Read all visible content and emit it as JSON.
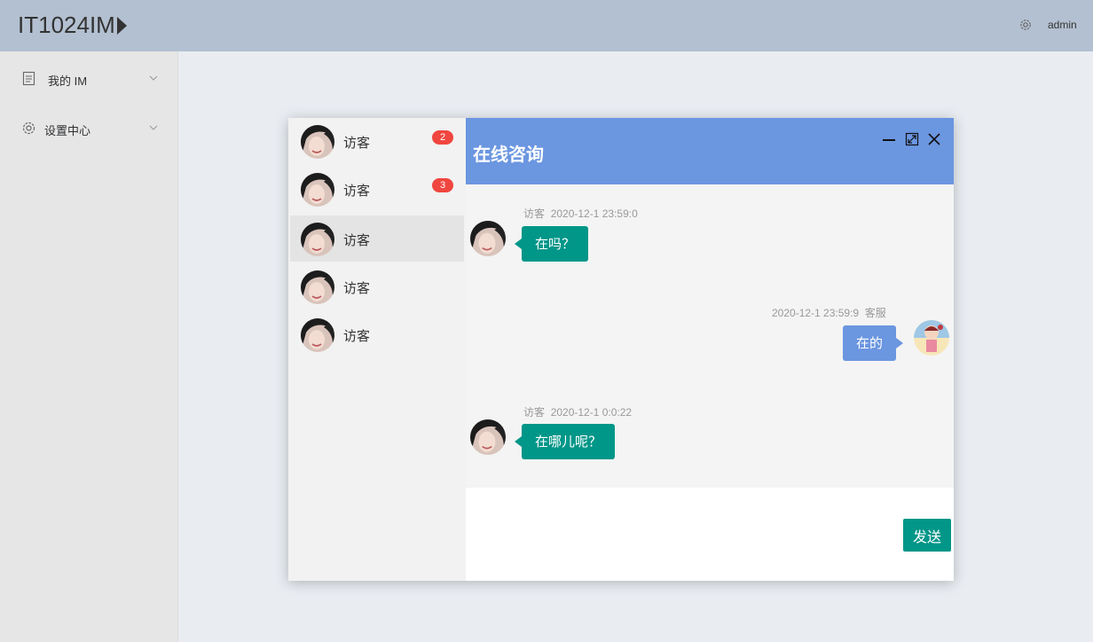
{
  "header": {
    "brand": "IT1024IM",
    "settings_icon": "gear-icon",
    "username": "admin"
  },
  "sidebar": {
    "items": [
      {
        "label": "我的 IM",
        "icon": "document-icon"
      },
      {
        "label": "设置中心",
        "icon": "gear-icon"
      }
    ]
  },
  "contacts": [
    {
      "name": "访客",
      "badge": "2",
      "active": false
    },
    {
      "name": "访客",
      "badge": "3",
      "active": false
    },
    {
      "name": "访客",
      "badge": "",
      "active": true
    },
    {
      "name": "访客",
      "badge": "",
      "active": false
    },
    {
      "name": "访客",
      "badge": "",
      "active": false
    }
  ],
  "chat": {
    "title": "在线咨询",
    "messages": [
      {
        "side": "left",
        "sender": "访客",
        "time": "2020-12-1 23:59:0",
        "text": "在吗？"
      },
      {
        "side": "right",
        "sender": "客服",
        "time": "2020-12-1 23:59:9",
        "text": "在的"
      },
      {
        "side": "left",
        "sender": "访客",
        "time": "2020-12-1 0:0:22",
        "text": "在哪儿呢？"
      }
    ],
    "send_label": "发送"
  },
  "colors": {
    "header_bg": "#b3c0d1",
    "chat_header": "#6b96e0",
    "teal": "#009688",
    "badge_red": "#f0463f"
  }
}
